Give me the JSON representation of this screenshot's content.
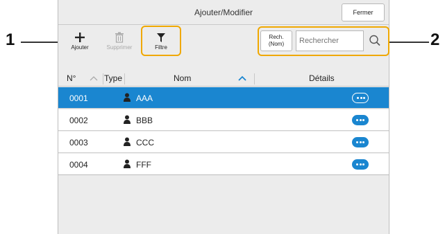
{
  "window": {
    "title": "Ajouter/Modifier",
    "close_label": "Fermer"
  },
  "toolbar": {
    "add_label": "Ajouter",
    "delete_label": "Supprimer",
    "filter_label": "Filtre"
  },
  "search": {
    "mode_label_line1": "Rech.",
    "mode_label_line2": "(Nom)",
    "placeholder": "Rechercher"
  },
  "table": {
    "columns": {
      "num": "N°",
      "type": "Type",
      "name": "Nom",
      "details": "Détails"
    },
    "rows": [
      {
        "num": "0001",
        "name": "AAA",
        "selected": true
      },
      {
        "num": "0002",
        "name": "BBB",
        "selected": false
      },
      {
        "num": "0003",
        "name": "CCC",
        "selected": false
      },
      {
        "num": "0004",
        "name": "FFF",
        "selected": false
      }
    ]
  },
  "callouts": {
    "left": "1",
    "right": "2"
  },
  "colors": {
    "accent": "#1a86d0",
    "highlight": "#f0a800",
    "panel": "#ececec"
  }
}
